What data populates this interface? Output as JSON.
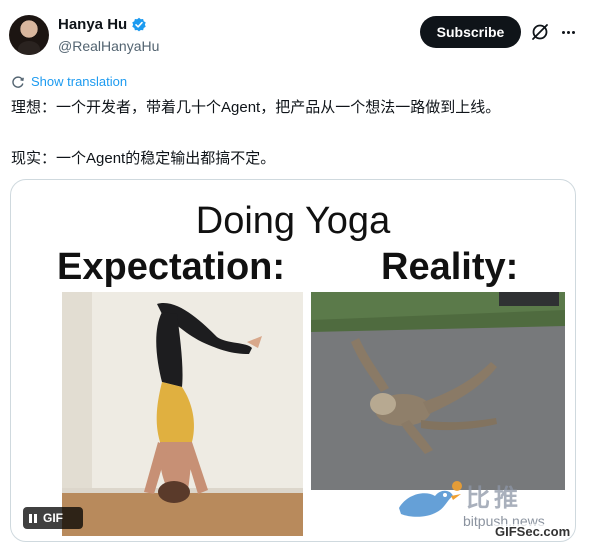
{
  "author": {
    "display_name": "Hanya Hu",
    "handle": "@RealHanyaHu"
  },
  "actions": {
    "subscribe_label": "Subscribe"
  },
  "translation": {
    "label": "Show translation"
  },
  "tweet": {
    "line1": "理想：一个开发者，带着几十个Agent，把产品从一个想法一路做到上线。",
    "line2": "现实：一个Agent的稳定输出都搞不定。"
  },
  "media": {
    "title": "Doing Yoga",
    "left_caption": "Expectation:",
    "right_caption": "Reality:",
    "badge_label": "GIF",
    "watermark_cn": "比推",
    "watermark_url": "bitpush.news",
    "watermark_gif": "GIFSec.com"
  },
  "colors": {
    "accent": "#1d9bf0",
    "button_bg": "#0f1419",
    "secondary_text": "#536471"
  },
  "icons": [
    "avatar",
    "verified-badge-icon",
    "grok-icon",
    "more-icon",
    "translate-icon",
    "pause-icon",
    "bird-logo"
  ]
}
